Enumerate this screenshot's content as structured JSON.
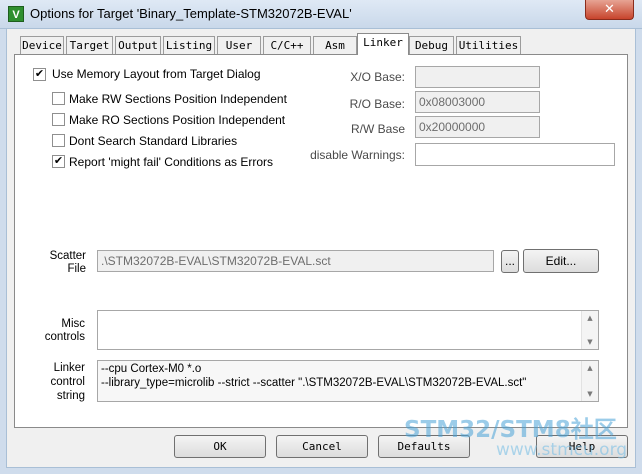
{
  "window": {
    "title": "Options for Target 'Binary_Template-STM32072B-EVAL'",
    "close_glyph": "✕",
    "icon_letter": "V"
  },
  "tabs": [
    {
      "label": "Device"
    },
    {
      "label": "Target"
    },
    {
      "label": "Output"
    },
    {
      "label": "Listing"
    },
    {
      "label": "User"
    },
    {
      "label": "C/C++"
    },
    {
      "label": "Asm"
    },
    {
      "label": "Linker"
    },
    {
      "label": "Debug"
    },
    {
      "label": "Utilities"
    }
  ],
  "active_tab": "Linker",
  "linker": {
    "options": [
      {
        "label": "Use Memory Layout from Target Dialog",
        "checked": true
      },
      {
        "label": "Make RW Sections Position Independent",
        "checked": false
      },
      {
        "label": "Make RO Sections Position Independent",
        "checked": false
      },
      {
        "label": "Dont Search Standard Libraries",
        "checked": false
      },
      {
        "label": "Report 'might fail' Conditions as Errors",
        "checked": true
      }
    ],
    "check_glyph": "✔",
    "xo_base": {
      "label": "X/O Base:",
      "value": ""
    },
    "ro_base": {
      "label": "R/O Base:",
      "value": "0x08003000"
    },
    "rw_base": {
      "label": "R/W Base",
      "value": "0x20000000"
    },
    "disable_warnings": {
      "label": "disable Warnings:",
      "value": ""
    },
    "scatter": {
      "label_line1": "Scatter",
      "label_line2": "File",
      "value": ".\\STM32072B-EVAL\\STM32072B-EVAL.sct",
      "browse_label": "...",
      "edit_label": "Edit..."
    },
    "misc": {
      "label_line1": "Misc",
      "label_line2": "controls",
      "value": ""
    },
    "control_string": {
      "label_line1": "Linker",
      "label_line2": "control",
      "label_line3": "string",
      "line1": "--cpu Cortex-M0 *.o",
      "line2": "--library_type=microlib --strict --scatter \".\\STM32072B-EVAL\\STM32072B-EVAL.sct\""
    },
    "scroll_up": "▲",
    "scroll_down": "▼"
  },
  "buttons": {
    "ok": "OK",
    "cancel": "Cancel",
    "defaults": "Defaults",
    "help": "Help"
  },
  "watermark": {
    "line1": "STM32/STM8社区",
    "line2": "www.stmcu.org"
  }
}
